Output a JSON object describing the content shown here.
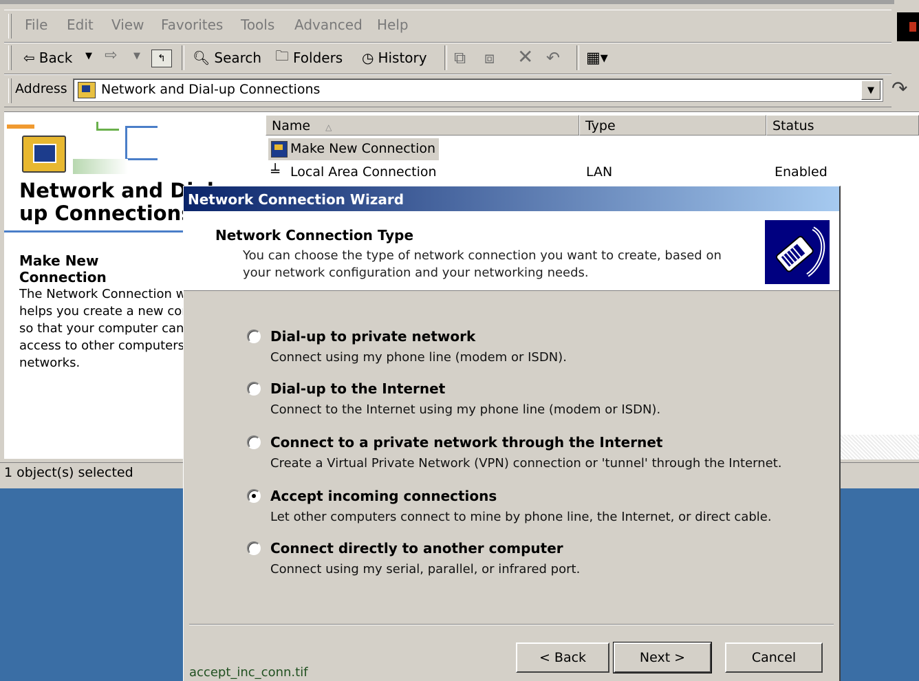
{
  "menu": [
    "File",
    "Edit",
    "View",
    "Favorites",
    "Tools",
    "Advanced",
    "Help"
  ],
  "toolbar": {
    "back": "Back",
    "search": "Search",
    "folders": "Folders",
    "history": "History"
  },
  "address": {
    "label": "Address",
    "value": "Network and Dial-up Connections"
  },
  "left_panel": {
    "title": "Network and Dial-\nup Connections",
    "heading": "Make New Connection",
    "description": "The Network Connection wizard\nhelps you create a new connection\nso that your computer can gain\naccess to other computers and\nnetworks."
  },
  "list": {
    "columns": [
      "Name",
      "Type",
      "Status"
    ],
    "rows": [
      {
        "name": "Make New Connection",
        "type": "",
        "status": "",
        "icon": "make-new-connection-icon"
      },
      {
        "name": "Local Area Connection",
        "type": "LAN",
        "status": "Enabled",
        "icon": "lan-connection-icon"
      }
    ]
  },
  "status_bar": "1 object(s) selected",
  "wizard": {
    "title": "Network Connection Wizard",
    "header_title": "Network Connection Type",
    "header_subtitle": "You can choose the type of network connection you want to create, based on your network configuration and your networking needs.",
    "options": [
      {
        "title": "Dial-up to private network",
        "desc": "Connect using my phone line (modem or ISDN).",
        "selected": false
      },
      {
        "title": "Dial-up to the Internet",
        "desc": "Connect to the Internet using my phone line (modem or ISDN).",
        "selected": false
      },
      {
        "title": "Connect to a private network through the Internet",
        "desc": "Create a Virtual Private Network (VPN) connection or 'tunnel' through the Internet.",
        "selected": false
      },
      {
        "title": "Accept incoming connections",
        "desc": "Let other computers connect to mine by phone line, the Internet, or direct cable.",
        "selected": true
      },
      {
        "title": "Connect directly to another computer",
        "desc": "Connect using my serial, parallel, or infrared port.",
        "selected": false
      }
    ],
    "buttons": {
      "back": "< Back",
      "next": "Next >",
      "cancel": "Cancel"
    }
  },
  "filename": "accept_inc_conn.tif",
  "colors": {
    "titlebar": "#0a246a",
    "desktop": "#3a6ea5",
    "face": "#d4d0c8"
  }
}
